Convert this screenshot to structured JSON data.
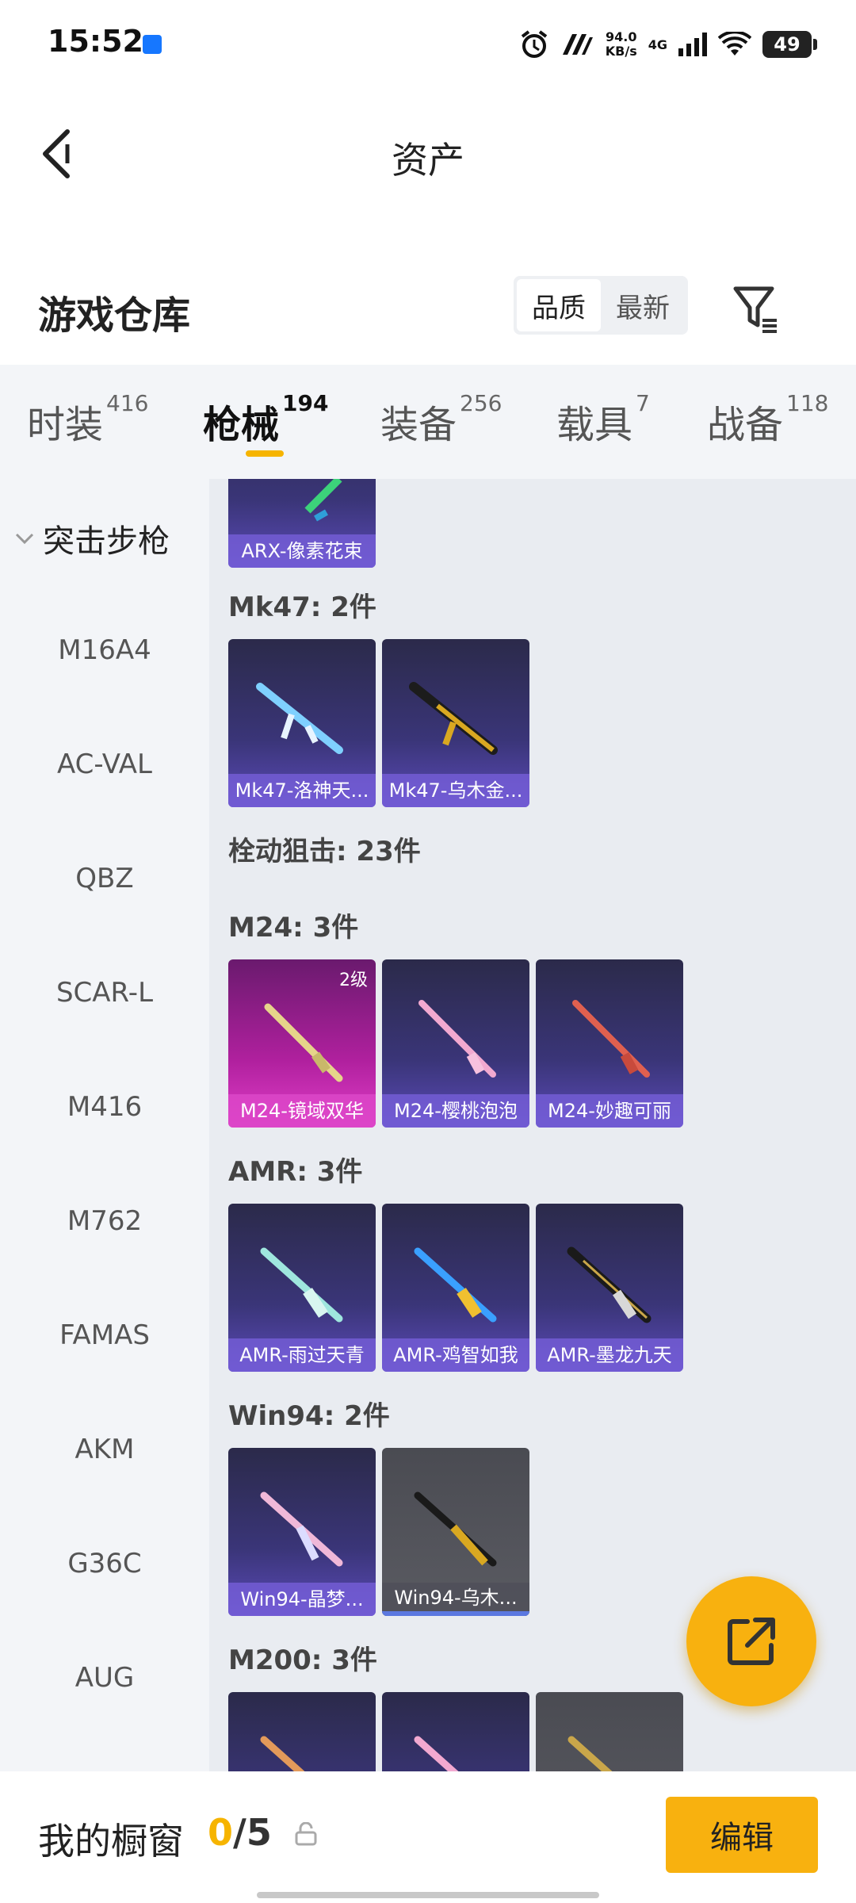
{
  "status_bar": {
    "time": "15:52",
    "net_speed_value": "94.0",
    "net_speed_unit": "KB/s",
    "network": "4G",
    "battery": "49"
  },
  "header": {
    "title": "资产"
  },
  "section": {
    "title": "游戏仓库",
    "sort_options": [
      "品质",
      "最新"
    ],
    "active_sort": "品质"
  },
  "tabs": [
    {
      "label": "时装",
      "count": "416"
    },
    {
      "label": "枪械",
      "count": "194"
    },
    {
      "label": "装备",
      "count": "256"
    },
    {
      "label": "载具",
      "count": "7"
    },
    {
      "label": "战备",
      "count": "118"
    }
  ],
  "active_tab": "枪械",
  "sidebar": {
    "group": "突击步枪",
    "items": [
      "M16A4",
      "AC-VAL",
      "QBZ",
      "SCAR-L",
      "M416",
      "M762",
      "FAMAS",
      "AKM",
      "G36C",
      "AUG"
    ]
  },
  "content": {
    "top_card": "ARX-像素花束",
    "groups": [
      {
        "label": "Mk47: 2件",
        "items": [
          {
            "name": "Mk47-洛神天...",
            "style": "purple"
          },
          {
            "name": "Mk47-乌木金...",
            "style": "purple"
          }
        ]
      },
      {
        "label": "栓动狙击: 23件",
        "items": []
      },
      {
        "label": "M24: 3件",
        "items": [
          {
            "name": "M24-镜域双华",
            "style": "pink",
            "level": "2级"
          },
          {
            "name": "M24-樱桃泡泡",
            "style": "purple"
          },
          {
            "name": "M24-妙趣可丽",
            "style": "purple"
          }
        ]
      },
      {
        "label": "AMR: 3件",
        "items": [
          {
            "name": "AMR-雨过天青",
            "style": "purple"
          },
          {
            "name": "AMR-鸡智如我",
            "style": "purple"
          },
          {
            "name": "AMR-墨龙九天",
            "style": "purple"
          }
        ]
      },
      {
        "label": "Win94: 2件",
        "items": [
          {
            "name": "Win94-晶梦...",
            "style": "purple"
          },
          {
            "name": "Win94-乌木...",
            "style": "grey"
          }
        ]
      },
      {
        "label": "M200: 3件",
        "items": []
      }
    ]
  },
  "bottom": {
    "window_label": "我的橱窗",
    "current": "0",
    "total": "/5",
    "edit_label": "编辑"
  },
  "colors": {
    "accent": "#f6b400",
    "card_purple": "#3a3578",
    "card_pink": "#b0209e"
  }
}
